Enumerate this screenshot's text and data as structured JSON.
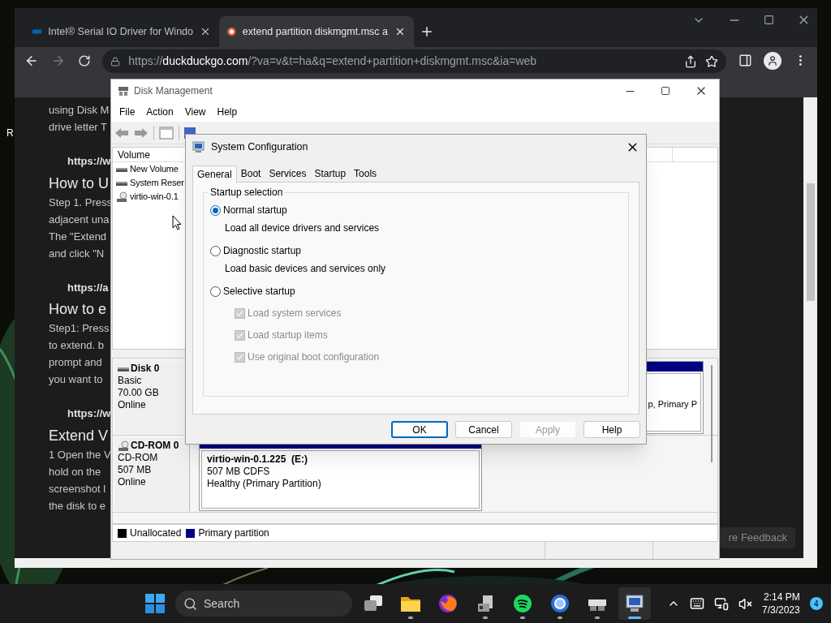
{
  "desktop": {
    "icon_label": "R"
  },
  "browser": {
    "tabs": [
      {
        "title": "Intel® Serial IO Driver for Windo",
        "selected": false
      },
      {
        "title": "extend partition diskmgmt.msc a",
        "selected": true
      }
    ],
    "url": "https://**duckduckgo.com**/?va=v&t=ha&q=extend+partition+diskmgmt.msc&ia=web",
    "article": [
      {
        "lines": [
          "using Disk M",
          "drive letter T"
        ]
      },
      {
        "link": "https://w",
        "heading": "How to U",
        "lines": [
          "Step 1. Press",
          "adjacent una",
          "The \"Extend",
          "and click \"N"
        ]
      },
      {
        "link": "https://a",
        "heading": "How to e",
        "lines": [
          "Step1: Press",
          "to extend. b",
          "prompt and",
          "you want to"
        ]
      },
      {
        "link": "https://w",
        "heading": "Extend V",
        "lines": [
          "1 Open the V",
          "hold on the",
          "screenshot l",
          "the disk to e"
        ]
      }
    ],
    "feedback_button": "re Feedback"
  },
  "disk_management": {
    "title": "Disk Management",
    "menu": [
      "File",
      "Action",
      "View",
      "Help"
    ],
    "volume_header": "Volume",
    "volumes": [
      {
        "name": "New Volume",
        "kind": "disk"
      },
      {
        "name": "System Reser",
        "kind": "disk"
      },
      {
        "name": "virtio-win-0.1",
        "kind": "cd"
      }
    ],
    "disks": [
      {
        "name": "Disk 0",
        "kind": "disk",
        "type": "Basic",
        "size": "70.00 GB",
        "status": "Online",
        "partition": {
          "lines": [
            "p, Primary P"
          ]
        }
      },
      {
        "name": "CD-ROM 0",
        "kind": "cd",
        "type": "CD-ROM",
        "size": "507 MB",
        "status": "Online",
        "partition": {
          "title": "virtio-win-0.1.225  (E:)",
          "lines": [
            "507 MB CDFS",
            "Healthy (Primary Partition)"
          ]
        }
      }
    ],
    "legend": [
      {
        "label": "Unallocated",
        "color": "#000000"
      },
      {
        "label": "Primary partition",
        "color": "#000080"
      }
    ]
  },
  "system_configuration": {
    "title": "System Configuration",
    "tabs": [
      {
        "label": "General",
        "selected": true
      },
      {
        "label": "Boot",
        "selected": false
      },
      {
        "label": "Services",
        "selected": false
      },
      {
        "label": "Startup",
        "selected": false
      },
      {
        "label": "Tools",
        "selected": false
      }
    ],
    "group_title": "Startup selection",
    "options": [
      {
        "label": "Normal startup",
        "description": "Load all device drivers and services",
        "selected": true
      },
      {
        "label": "Diagnostic startup",
        "description": "Load basic devices and services only",
        "selected": false
      },
      {
        "label": "Selective startup",
        "selected": false,
        "items": [
          {
            "label": "Load system services",
            "checked": true,
            "disabled": true
          },
          {
            "label": "Load startup items",
            "checked": true,
            "disabled": true
          },
          {
            "label": "Use original boot configuration",
            "checked": true,
            "disabled": true
          }
        ]
      }
    ],
    "buttons": [
      {
        "label": "OK",
        "default": true,
        "disabled": false
      },
      {
        "label": "Cancel",
        "default": false,
        "disabled": false
      },
      {
        "label": "Apply",
        "default": false,
        "disabled": true
      },
      {
        "label": "Help",
        "default": false,
        "disabled": false
      }
    ]
  },
  "taskbar": {
    "search_placeholder": "Search",
    "apps": [
      {
        "kind": "taskview",
        "running": false,
        "selected": false
      },
      {
        "kind": "folder",
        "running": true,
        "selected": false
      },
      {
        "kind": "fox",
        "running": false,
        "selected": false
      },
      {
        "kind": "server",
        "running": true,
        "selected": false
      },
      {
        "kind": "music",
        "running": true,
        "selected": false
      },
      {
        "kind": "ring",
        "running": true,
        "selected": false
      },
      {
        "kind": "boxes",
        "running": true,
        "selected": false
      },
      {
        "kind": "monitor",
        "running": true,
        "selected": true
      }
    ],
    "time": "2:14 PM",
    "date": "7/3/2023",
    "notification_count": "4"
  }
}
